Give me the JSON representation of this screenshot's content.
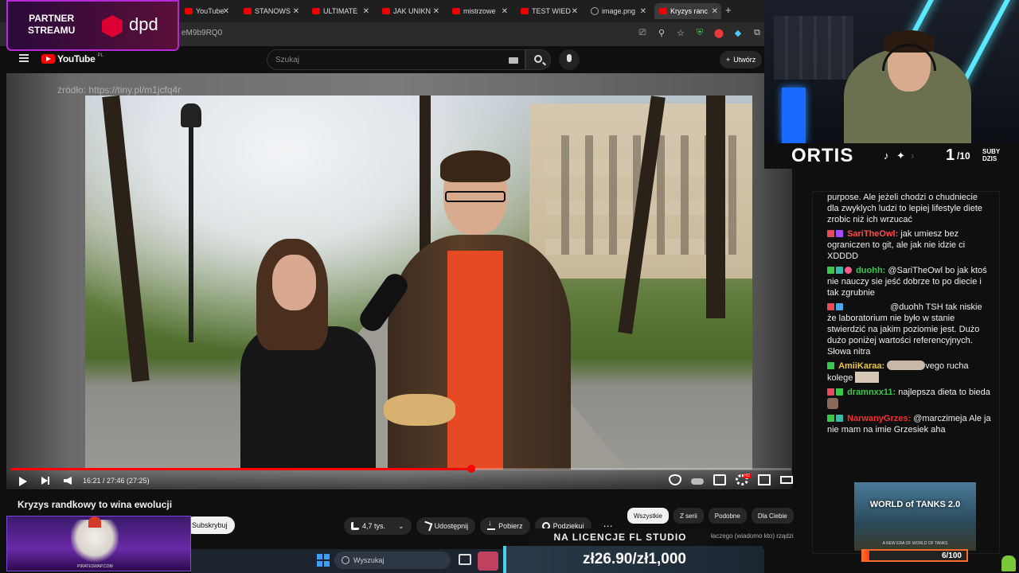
{
  "browser": {
    "tabs": [
      {
        "label": "YouTube",
        "icon": "youtube-icon"
      },
      {
        "label": "STANOWS",
        "icon": "youtube-icon"
      },
      {
        "label": "ULTIMATE",
        "icon": "youtube-icon"
      },
      {
        "label": "JAK UNIKN",
        "icon": "youtube-icon"
      },
      {
        "label": "mistrzowe",
        "icon": "youtube-icon"
      },
      {
        "label": "TEST WIED",
        "icon": "youtube-icon"
      },
      {
        "label": "image.png",
        "icon": "globe-icon"
      },
      {
        "label": "Kryzys ranc",
        "icon": "youtube-icon"
      }
    ],
    "new_tab": "+",
    "url": "eM9b9RQ0"
  },
  "youtube": {
    "logo_text": "YouTube",
    "logo_region": "PL",
    "search_placeholder": "Szukaj",
    "create_label": "Utwórz"
  },
  "video": {
    "watermark": "źródło: https://tiny.pl/m1jcfq4r",
    "time": "16:21 / 27:46 (27:25)",
    "progress": 0.59,
    "title": "Kryzys randkowy to wina ewolucji",
    "subscribe_label": "Subskrybuj",
    "actions": {
      "likes": "4,7 tys.",
      "share": "Udostępnij",
      "download": "Pobierz",
      "thanks": "Podziękuj"
    },
    "chips": [
      "Wszystkie",
      "Z serii",
      "Podobne",
      "Dla Ciebie"
    ],
    "rec_text": "łaczego (wiadomo kto) rządzi"
  },
  "overlays": {
    "dpd_line1": "PARTNER",
    "dpd_line2": "STREAMU",
    "dpd_logo": "dpd",
    "pirate_url": "PIRATESWAP.COM",
    "fl_banner": "NA LICENCJE FL STUDIO",
    "price": "zł26.90/zł1,000"
  },
  "taskbar": {
    "search_label": "Wyszukaj"
  },
  "stream": {
    "name": "ORTIS",
    "subs_now": "1",
    "subs_goal": "/10",
    "subs_label_1": "SUBY",
    "subs_label_2": "DZIS"
  },
  "chat": {
    "messages": [
      {
        "user": "",
        "text": "purpose. Ale jeżeli chodzi o chudniecie dla zwyklych ludzi to lepiej lifestyle diete zrobic niż ich wrzucać"
      },
      {
        "user": "SariTheOwl:",
        "color": "#ff4a4a",
        "text": "jak umiesz bez ograniczen to git, ale jak nie idzie ci XDDDD"
      },
      {
        "user": "duohh:",
        "color": "#3ac84a",
        "text": "@SariTheOwl bo jak ktoś nie nauczy sie jeść dobrze to po diecie i tak zgrubnie"
      },
      {
        "user": "",
        "text": "@duohh TSH tak niskie że laboratorium nie było w stanie stwierdzić na jakim poziomie jest. Dużo dużo poniżej wartości referencyjnych. Słowa nitra"
      },
      {
        "user": "AmiiKaraa:",
        "color": "#e8c83a",
        "text_a": "vego",
        "text_b": "rucha kolege"
      },
      {
        "user": "dramnxx11:",
        "color": "#3ac84a",
        "text": "najlepsza dieta to bieda"
      },
      {
        "user": "NarwanyGrzes:",
        "color": "#ff2a2a",
        "text": "@marczimeja Ale ja nie mam na imie Grzesiek aha"
      }
    ]
  },
  "ad": {
    "title": "WORLD of TANKS 2.0",
    "subtitle": "A NEW ERA OF WORLD OF TANKS",
    "goal_text": "6/100",
    "goal_value": 0.06
  }
}
